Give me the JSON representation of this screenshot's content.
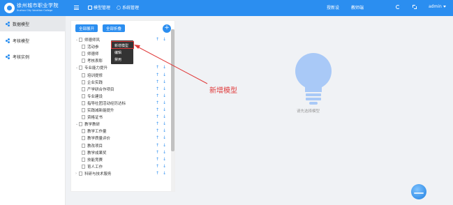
{
  "brand": {
    "name_cn": "徐州城市职业学院",
    "name_en": "Xuzhou City Vocation College"
  },
  "topnav": {
    "model_mgmt": "模型管理",
    "system_mgmt": "系统管理"
  },
  "topright": {
    "teaching": "授新设",
    "teacher": "教师端",
    "user": "admin"
  },
  "sidebar": {
    "items": [
      {
        "label": "数据模型",
        "active": true
      },
      {
        "label": "考核模型",
        "active": false
      },
      {
        "label": "考核实例",
        "active": false
      }
    ]
  },
  "panel": {
    "expand_all": "全部展开",
    "collapse_all": "全部折叠",
    "tree": [
      {
        "label": "师德师风",
        "level": 0
      },
      {
        "label": "活动参",
        "level": 1
      },
      {
        "label": "师德师",
        "level": 1
      },
      {
        "label": "考核表彰",
        "level": 1
      },
      {
        "label": "专业能力提升",
        "level": 0
      },
      {
        "label": "培训提修",
        "level": 1
      },
      {
        "label": "企业实践",
        "level": 1
      },
      {
        "label": "产学研合作项目",
        "level": 1
      },
      {
        "label": "专业建设",
        "level": 1
      },
      {
        "label": "指导社团活动经历达标",
        "level": 1
      },
      {
        "label": "实践减新能提升",
        "level": 1
      },
      {
        "label": "资格证书",
        "level": 1
      },
      {
        "label": "教学教研",
        "level": 0
      },
      {
        "label": "教学工作量",
        "level": 1
      },
      {
        "label": "教学质量评价",
        "level": 1
      },
      {
        "label": "教改项目",
        "level": 1
      },
      {
        "label": "教学成果奖",
        "level": 1
      },
      {
        "label": "技能竞赛",
        "level": 1
      },
      {
        "label": "育人工作",
        "level": 1
      },
      {
        "label": "科研与技术服务",
        "level": 0
      }
    ]
  },
  "context_menu": {
    "items": [
      "新增模型",
      "编辑",
      "禁用"
    ]
  },
  "annotation": {
    "text": "新增模型",
    "color": "#e03a3a"
  },
  "main": {
    "placeholder": "请先选择模型"
  },
  "colors": {
    "primary": "#2b8ef0",
    "bulb": "#a9c9f7"
  }
}
